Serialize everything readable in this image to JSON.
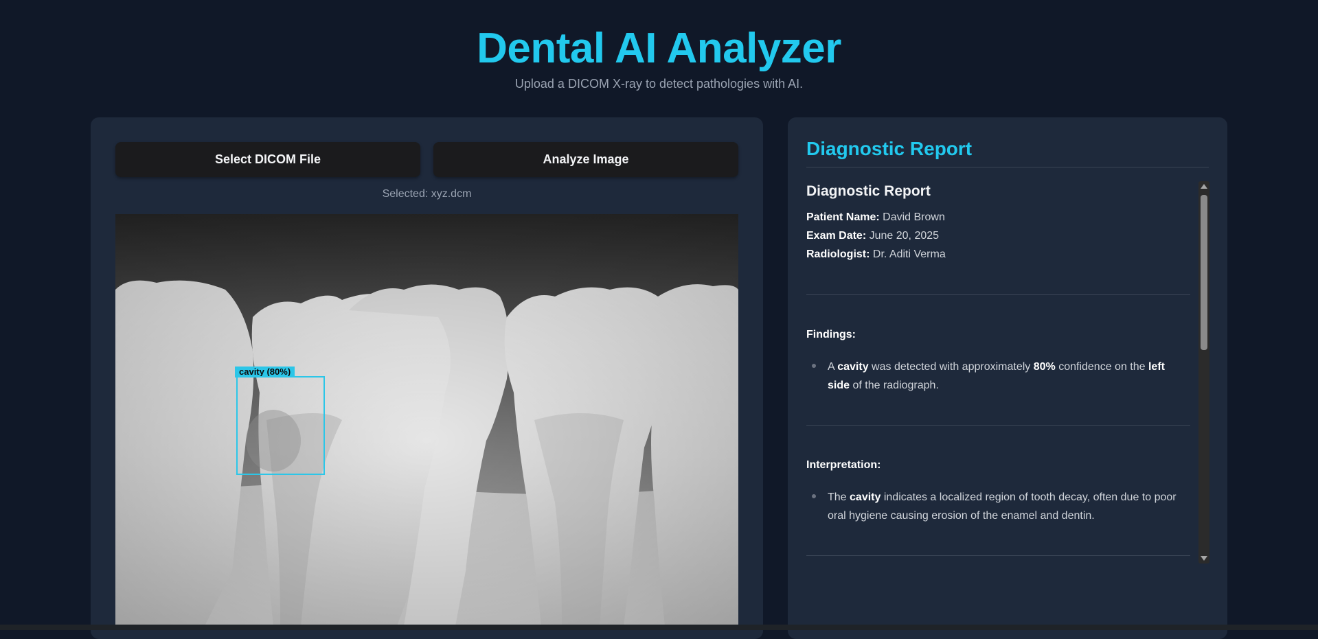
{
  "header": {
    "title": "Dental AI Analyzer",
    "subtitle": "Upload a DICOM X-ray to detect pathologies with AI."
  },
  "upload": {
    "select_label": "Select DICOM File",
    "analyze_label": "Analyze Image",
    "selected_text": "Selected: xyz.dcm"
  },
  "detection": {
    "label": "cavity (80%)",
    "class": "cavity",
    "confidence": 0.8,
    "color": "#2cc6e8"
  },
  "report": {
    "panel_heading": "Diagnostic Report",
    "title": "Diagnostic Report",
    "patient_label": "Patient Name:",
    "patient_value": "David Brown",
    "exam_label": "Exam Date:",
    "exam_value": "June 20, 2025",
    "radiologist_label": "Radiologist:",
    "radiologist_value": "Dr. Aditi Verma",
    "findings_title": "Findings:",
    "findings": {
      "t1": "A ",
      "b1": "cavity",
      "t2": " was detected with approximately ",
      "b2": "80%",
      "t3": " confidence on the ",
      "b3": "left side",
      "t4": " of the radiograph."
    },
    "interpretation_title": "Interpretation:",
    "interpretation": {
      "t1": "The ",
      "b1": "cavity",
      "t2": " indicates a localized region of tooth decay, often due to poor oral hygiene causing erosion of the enamel and dentin."
    }
  },
  "colors": {
    "accent": "#22c9ee",
    "background": "#101828",
    "panel": "#1e293b",
    "button": "#1b1b1d"
  }
}
